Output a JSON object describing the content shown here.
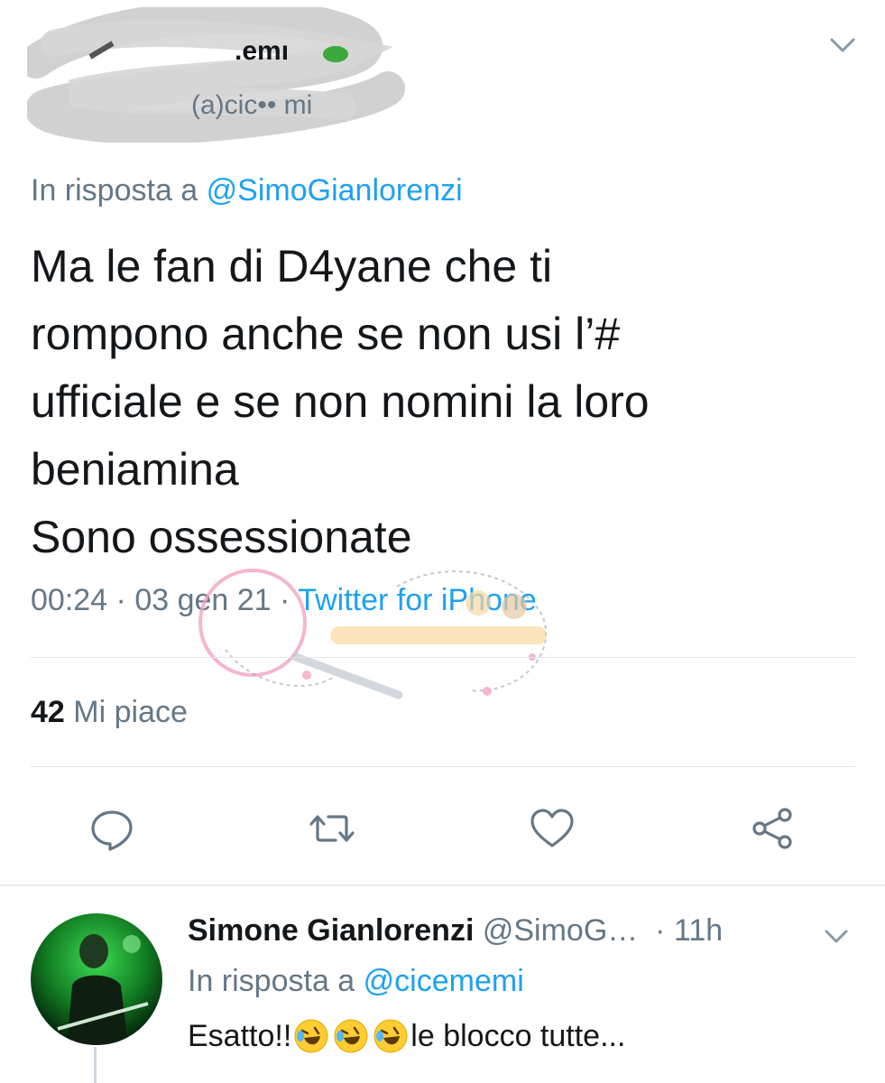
{
  "main_tweet": {
    "handle_fragment": "(a)cic•• mi",
    "reply_prefix": "In risposta a",
    "reply_to": "@SimoGianlorenzi",
    "body_lines": [
      "Ma le fan di D4yane che ti",
      "rompono anche se non usi l’#",
      "ufficiale e se non nomini la loro",
      "beniamina",
      "Sono ossessionate"
    ],
    "time": "00:24",
    "date": "03 gen 21",
    "source": "Twitter for iPhone",
    "likes_count": "42",
    "likes_label": "Mi piace"
  },
  "actions": {
    "reply_icon": "comment-bubble-icon",
    "retweet_icon": "retweet-icon",
    "like_icon": "heart-icon",
    "share_icon": "share-icon"
  },
  "reply_tweet": {
    "author_name": "Simone Gianlorenzi",
    "author_handle": "@SimoG…",
    "age": "11h",
    "reply_prefix": "In risposta a",
    "reply_to": "@cicememi",
    "text_start": "Esatto!!",
    "text_end": "le blocco tutte..."
  },
  "colors": {
    "link": "#1da1f2",
    "muted": "#657786",
    "text": "#14171a",
    "divider": "#e1e8ed"
  }
}
